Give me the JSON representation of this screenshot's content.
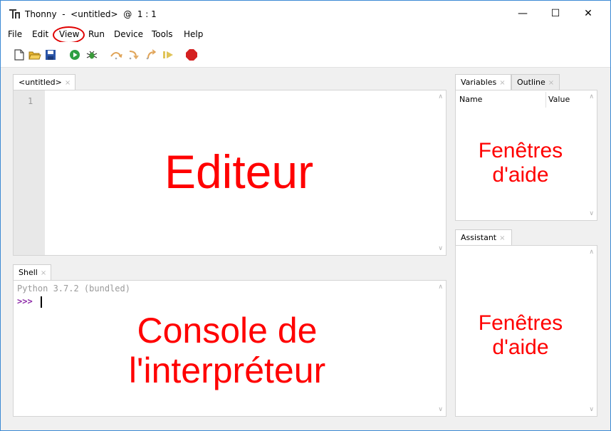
{
  "window": {
    "title": "Thonny  -  <untitled>  @  1 : 1",
    "controls": {
      "minimize": "—",
      "maximize": "☐",
      "close": "✕"
    }
  },
  "menu": {
    "items": [
      "File",
      "Edit",
      "View",
      "Run",
      "Device",
      "Tools",
      "Help"
    ],
    "highlighted": "View",
    "highlight_color": "#e00000"
  },
  "toolbar": {
    "icons": [
      "new-file-icon",
      "open-file-icon",
      "save-icon",
      "run-icon",
      "debug-icon",
      "step-over-icon",
      "step-into-icon",
      "step-out-icon",
      "resume-icon",
      "stop-icon"
    ]
  },
  "editor": {
    "tab_label": "<untitled>",
    "tab_close": "×",
    "line_numbers": [
      "1"
    ],
    "overlay_label": "Editeur"
  },
  "shell": {
    "tab_label": "Shell",
    "tab_close": "×",
    "banner": "Python 3.7.2 (bundled)",
    "prompt": ">>>",
    "overlay_label_line1": "Console de",
    "overlay_label_line2": "l'interpréteur"
  },
  "variables": {
    "tab_label": "Variables",
    "tab_close": "×",
    "outline_tab_label": "Outline",
    "outline_tab_close": "×",
    "columns": [
      "Name",
      "Value"
    ],
    "overlay_label_line1": "Fenêtres",
    "overlay_label_line2": "d'aide"
  },
  "assistant": {
    "tab_label": "Assistant",
    "tab_close": "×",
    "overlay_label_line1": "Fenêtres",
    "overlay_label_line2": "d'aide"
  },
  "colors": {
    "annotation": "#ff0000",
    "prompt": "#8e2ca9",
    "window_border": "#3c8ad4"
  }
}
